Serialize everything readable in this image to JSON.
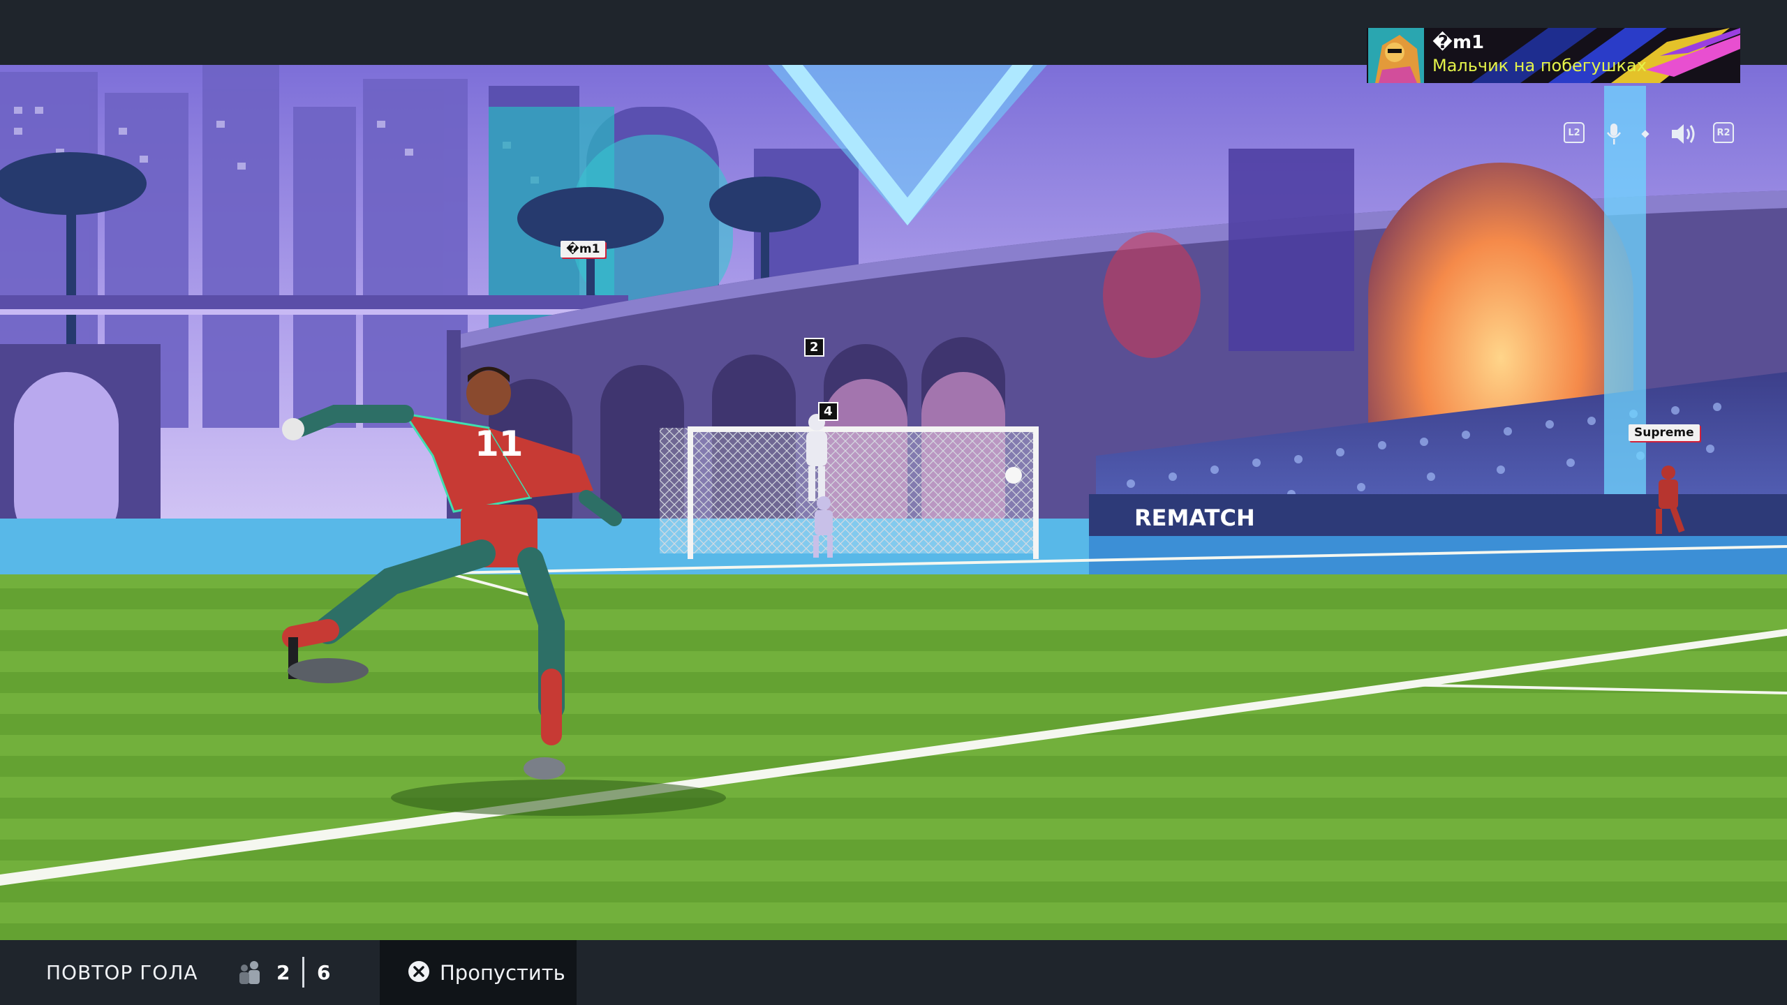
{
  "profile": {
    "name": "�m1",
    "subtitle": "Мальчик на побегушках"
  },
  "controls": {
    "left_trigger": "L2",
    "right_trigger": "R2",
    "icons": [
      "mic-icon",
      "speaker-icon"
    ]
  },
  "scene": {
    "name_tags": [
      "�m1",
      "Supreme"
    ],
    "player_numbers": [
      "2",
      "4"
    ],
    "shooter_number": "11",
    "board_text": [
      "REMATCH"
    ]
  },
  "bottom_bar": {
    "replay_label": "ПОВТОР ГОЛА",
    "score_left": "2",
    "score_right": "6",
    "skip_label": "Пропустить",
    "skip_icon": "cross-button-icon"
  },
  "colors": {
    "bar": "#1f252c",
    "accent_yellow": "#e4f34a",
    "tag_red": "#d1213a",
    "pitch": "#6aa838"
  }
}
